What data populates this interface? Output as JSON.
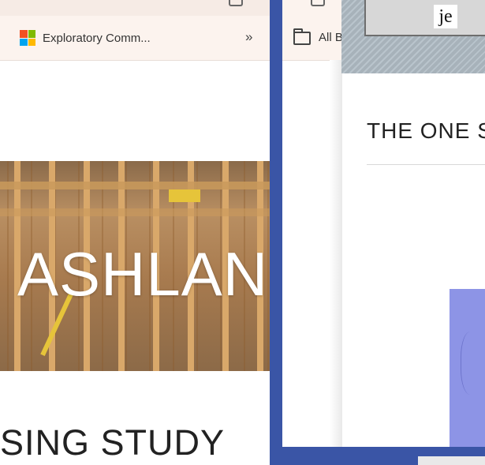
{
  "left_window": {
    "bookmark_label": "Exploratory Comm...",
    "overflow_chevron": "»",
    "hero_title": "ASHLAND",
    "subtitle": "SING STUDY",
    "ms_logo_colors": [
      "#f25022",
      "#7fba00",
      "#00a4ef",
      "#ffb900"
    ]
  },
  "right_window": {
    "bookmarks_label": "All B",
    "logo_text": "je",
    "page_title": "THE ONE S"
  },
  "colors": {
    "desktop_background": "#3a55a6",
    "toolbar": "#fcf3ee",
    "map_block": "#8d94e6"
  }
}
